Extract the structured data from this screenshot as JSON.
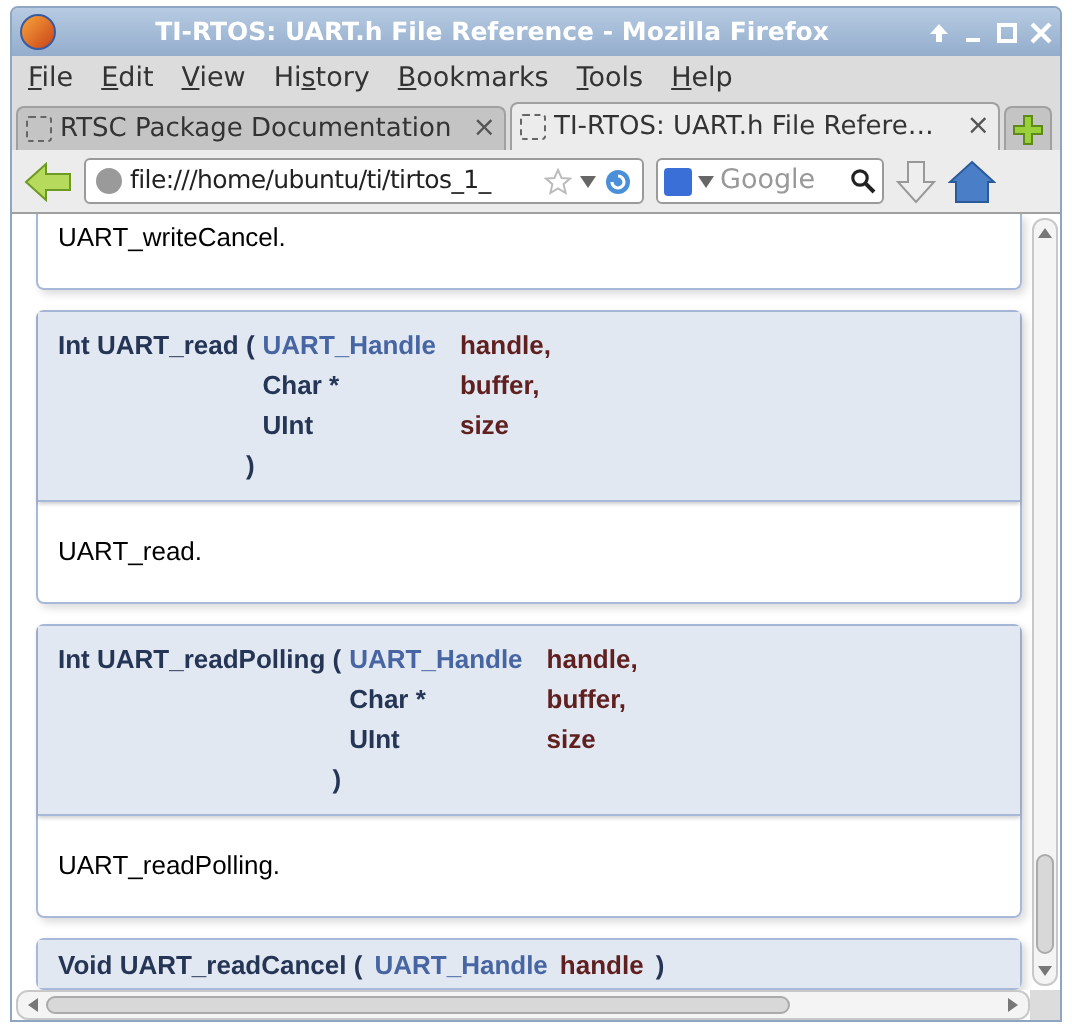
{
  "window": {
    "title": "TI-RTOS: UART.h File Reference - Mozilla Firefox"
  },
  "menu": [
    {
      "key": "F",
      "post": "ile"
    },
    {
      "key": "E",
      "post": "dit"
    },
    {
      "key": "V",
      "post": "iew"
    },
    {
      "pre": "Hi",
      "key": "s",
      "post": "tory"
    },
    {
      "key": "B",
      "post": "ookmarks"
    },
    {
      "key": "T",
      "post": "ools"
    },
    {
      "key": "H",
      "post": "elp"
    }
  ],
  "tabs": [
    {
      "label": "RTSC Package Documentation",
      "selected": false,
      "close": "×"
    },
    {
      "label": "TI-RTOS: UART.h File Refere…",
      "selected": true,
      "close": "×"
    }
  ],
  "address": {
    "value": "file:///home/ubuntu/ti/tirtos_1_"
  },
  "search": {
    "placeholder": "Google"
  },
  "cards": [
    {
      "description": "UART_writeCancel."
    },
    {
      "return_type": "Int",
      "name": "UART_read",
      "open": "(",
      "close": ")",
      "params": [
        {
          "type": "UART_Handle",
          "link": true,
          "name": "handle,"
        },
        {
          "type": "Char *",
          "link": false,
          "name": "buffer,"
        },
        {
          "type": "UInt",
          "link": false,
          "name": "size"
        }
      ],
      "description": "UART_read."
    },
    {
      "return_type": "Int",
      "name": "UART_readPolling",
      "open": "(",
      "close": ")",
      "params": [
        {
          "type": "UART_Handle",
          "link": true,
          "name": "handle,"
        },
        {
          "type": "Char *",
          "link": false,
          "name": "buffer,"
        },
        {
          "type": "UInt",
          "link": false,
          "name": "size"
        }
      ],
      "description": "UART_readPolling."
    },
    {
      "return_type": "Void",
      "name": "UART_readCancel",
      "open": "(",
      "close": ")",
      "params": [
        {
          "type": "UART_Handle",
          "link": true,
          "name": "handle"
        }
      ]
    }
  ]
}
